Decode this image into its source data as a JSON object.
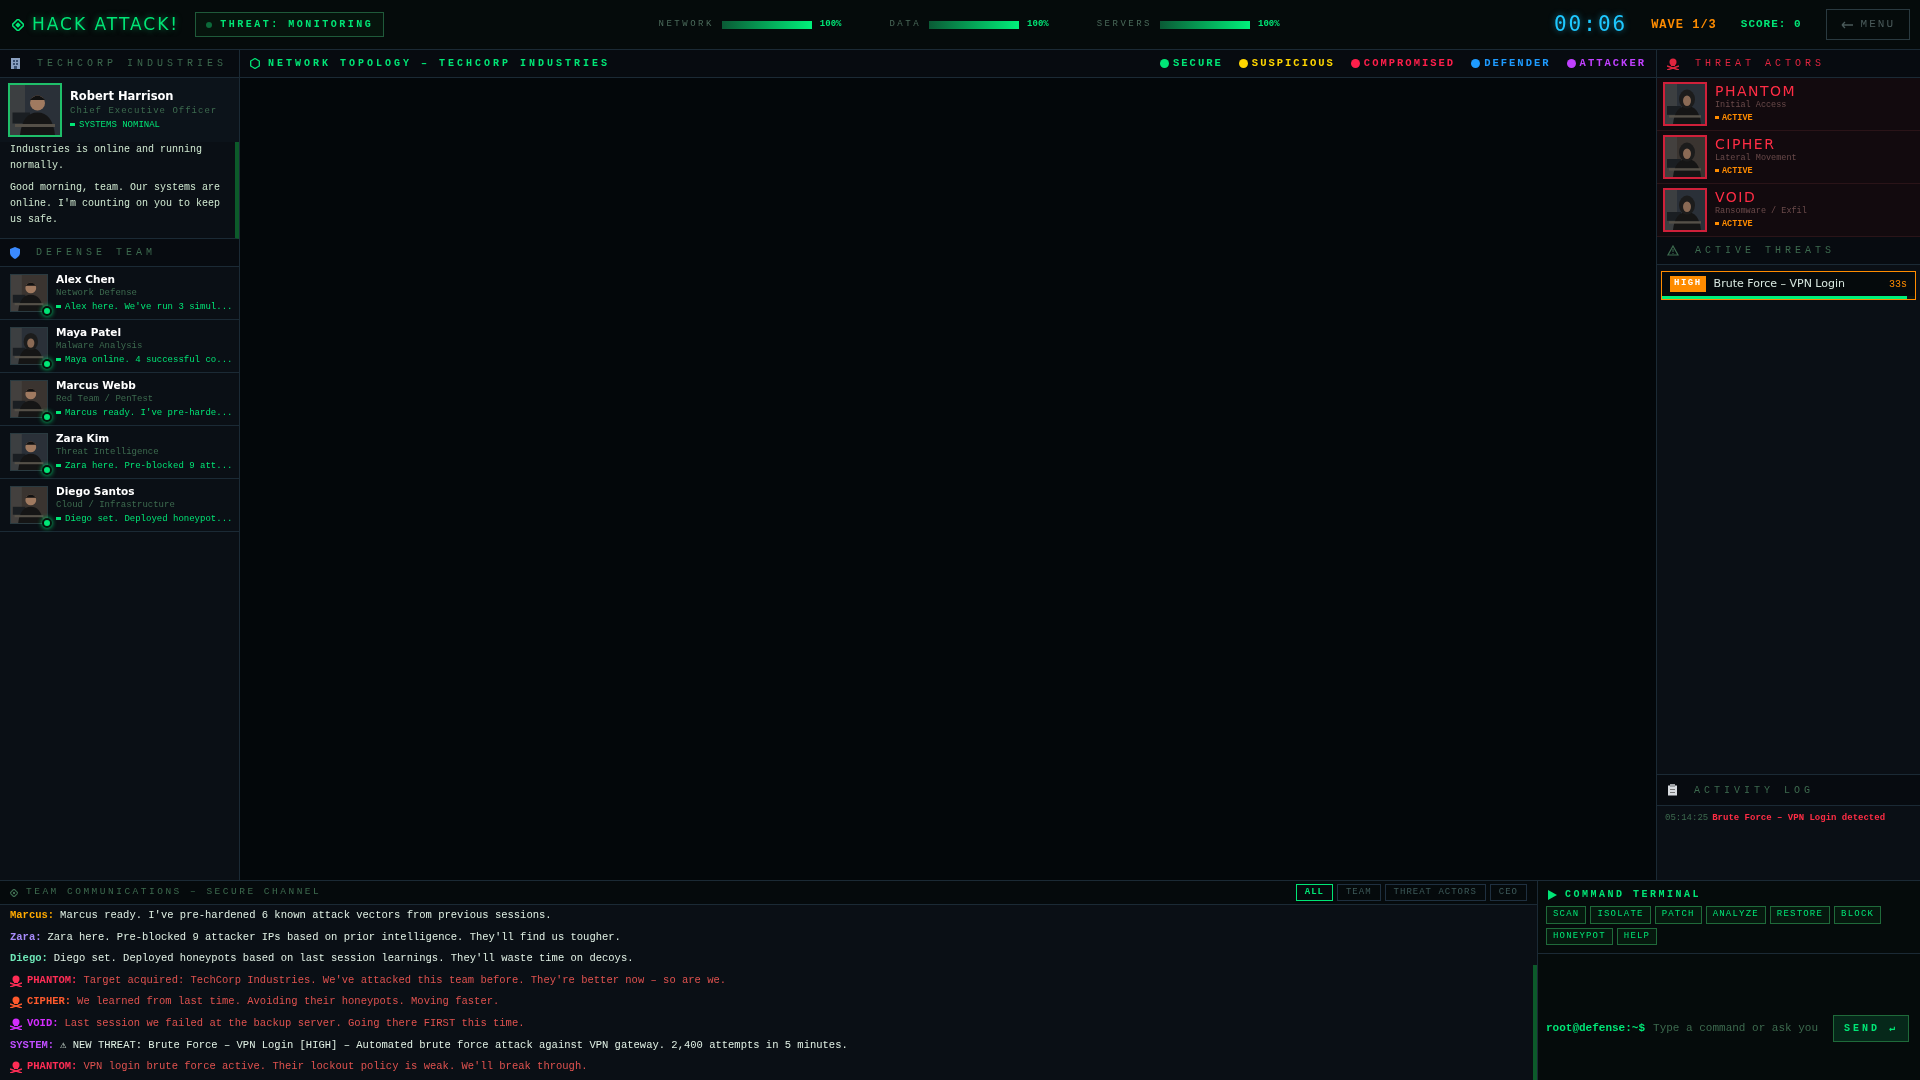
{
  "header": {
    "title": "HACK ATTACK!",
    "threat": "THREAT: MONITORING",
    "meters": [
      {
        "label": "NETWORK",
        "level": 1,
        "reading": "100%"
      },
      {
        "label": "DATA",
        "level": 1,
        "reading": "100%"
      },
      {
        "label": "SERVERS",
        "level": 1,
        "reading": "100%"
      }
    ],
    "timer": "00:06",
    "wave": "WAVE 1/3",
    "score": "SCORE: 0",
    "menu": "MENU"
  },
  "company": {
    "title": "TECHCORP INDUSTRIES",
    "ceo": {
      "name": "Robert Harrison",
      "role": "Chief Executive Officer",
      "status": "SYSTEMS NOMINAL"
    },
    "messages": [
      "Industries is online and running normally.",
      "Good morning, team. Our systems are online. I'm counting on you to keep us safe."
    ]
  },
  "defense_team": {
    "title": "DEFENSE TEAM",
    "members": [
      {
        "name": "Alex Chen",
        "role": "Network Defense",
        "message": "Alex here. We've run 3 simul...",
        "online": true
      },
      {
        "name": "Maya Patel",
        "role": "Malware Analysis",
        "message": "Maya online. 4 successful co...",
        "online": true
      },
      {
        "name": "Marcus Webb",
        "role": "Red Team / PenTest",
        "message": "Marcus ready. I've pre-harde...",
        "online": true
      },
      {
        "name": "Zara Kim",
        "role": "Threat Intelligence",
        "message": "Zara here. Pre-blocked 9 att...",
        "online": true
      },
      {
        "name": "Diego Santos",
        "role": "Cloud / Infrastructure",
        "message": "Diego set. Deployed honeypot...",
        "online": true
      }
    ]
  },
  "topology": {
    "title": "NETWORK TOPOLOGY – TECHCORP INDUSTRIES",
    "legend": [
      {
        "label": "SECURE",
        "color": "#00e676"
      },
      {
        "label": "SUSPICIOUS",
        "color": "#ffd600"
      },
      {
        "label": "COMPROMISED",
        "color": "#ff1f4b"
      },
      {
        "label": "DEFENDER",
        "color": "#1e9bff"
      },
      {
        "label": "ATTACKER",
        "color": "#c040ff"
      }
    ]
  },
  "threat_actors": {
    "title": "THREAT ACTORS",
    "actors": [
      {
        "name": "PHANTOM",
        "role": "Initial Access",
        "status": "ACTIVE"
      },
      {
        "name": "CIPHER",
        "role": "Lateral Movement",
        "status": "ACTIVE"
      },
      {
        "name": "VOID",
        "role": "Ransomware / Exfil",
        "status": "ACTIVE"
      }
    ]
  },
  "active_threats": {
    "title": "ACTIVE THREATS",
    "threats": [
      {
        "severity": "HIGH",
        "title": "Brute Force – VPN Login",
        "time": "33s",
        "level": 0.97
      }
    ]
  },
  "activity_log": {
    "title": "ACTIVITY LOG",
    "entries": [
      {
        "time": "05:14:25",
        "text": "Brute Force – VPN Login detected"
      }
    ]
  },
  "comms": {
    "title": "TEAM COMMUNICATIONS – SECURE CHANNEL",
    "filters": [
      {
        "label": "ALL",
        "selected": true
      },
      {
        "label": "TEAM",
        "selected": false
      },
      {
        "label": "THREAT ACTORS",
        "selected": false
      },
      {
        "label": "CEO",
        "selected": false
      }
    ],
    "messages": [
      {
        "kind": "team",
        "speaker": "Marcus:",
        "color": "#ffaa00",
        "text": "Marcus ready. I've pre-hardened 6 known attack vectors from previous sessions."
      },
      {
        "kind": "team",
        "speaker": "Zara:",
        "color": "#a78bfa",
        "text": "Zara here. Pre-blocked 9 attacker IPs based on prior intelligence. They'll find us tougher."
      },
      {
        "kind": "team",
        "speaker": "Diego:",
        "color": "#6ee7b7",
        "text": "Diego set. Deployed honeypots based on last session learnings. They'll waste time on decoys."
      },
      {
        "kind": "actor",
        "speaker": "PHANTOM:",
        "color": "#ff2d55",
        "text": "Target acquired: TechCorp Industries. We've attacked this team before. They're better now – so are we."
      },
      {
        "kind": "actor",
        "speaker": "CIPHER:",
        "color": "#ff5a2d",
        "text": "We learned from last time. Avoiding their honeypots. Moving faster."
      },
      {
        "kind": "actor",
        "speaker": "VOID:",
        "color": "#d42dff",
        "text": "Last session we failed at the backup server. Going there FIRST this time."
      },
      {
        "kind": "system",
        "speaker": "SYSTEM:",
        "color": "#c04dff",
        "text": "⚠ NEW THREAT: Brute Force – VPN Login [HIGH] – Automated brute force attack against VPN gateway. 2,400 attempts in 5 minutes."
      },
      {
        "kind": "actor",
        "speaker": "PHANTOM:",
        "color": "#ff2d55",
        "text": "VPN login brute force active. Their lockout policy is weak. We'll break through."
      }
    ]
  },
  "terminal": {
    "title": "COMMAND TERMINAL",
    "commands": [
      "SCAN",
      "ISOLATE",
      "PATCH",
      "ANALYZE",
      "RESTORE",
      "BLOCK",
      "HONEYPOT",
      "HELP"
    ],
    "prompt": "root@defense:~$",
    "placeholder": "Type a command or ask you",
    "send": "SEND ↵"
  }
}
